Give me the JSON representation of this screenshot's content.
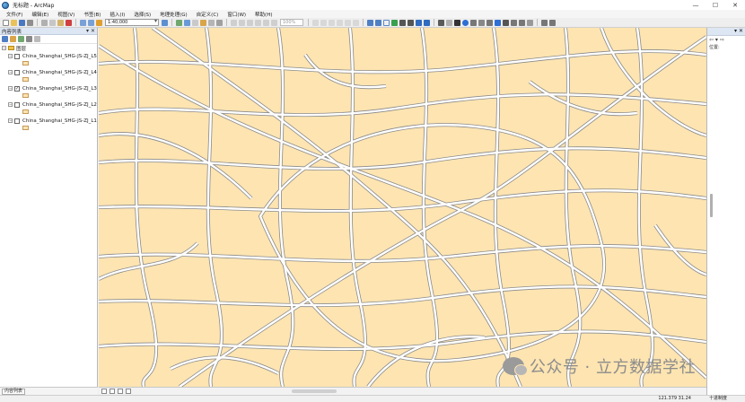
{
  "window": {
    "title": "无标题 - ArcMap",
    "controls": {
      "minimize": "—",
      "maximize": "☐",
      "close": "✕"
    }
  },
  "menu": [
    "文件(F)",
    "编辑(E)",
    "视图(V)",
    "书签(B)",
    "插入(I)",
    "选择(S)",
    "地理处理(G)",
    "自定义(C)",
    "窗口(W)",
    "帮助(H)"
  ],
  "toolbar": {
    "scale": "1:40,000",
    "zoom_level": "100%",
    "icons": [
      "new-file-icon",
      "open-icon",
      "save-icon",
      "print-icon",
      "cut-icon",
      "copy-icon",
      "paste-icon",
      "delete-icon",
      "undo-icon",
      "redo-icon",
      "add-data-icon",
      "zoom-in-icon",
      "zoom-out-icon",
      "pan-icon",
      "full-extent-icon",
      "select-icon",
      "identify-icon",
      "measure-icon"
    ]
  },
  "toc": {
    "title": "内容列表",
    "header_buttons": "▾ ✕",
    "root_label": "图层",
    "layers": [
      {
        "name": "China_Shanghai_SHG-JS-ZJ_L5",
        "checked": false
      },
      {
        "name": "China_Shanghai_SHG-JS-ZJ_L4",
        "checked": false
      },
      {
        "name": "China_Shanghai_SHG-JS-ZJ_L3",
        "checked": true
      },
      {
        "name": "China_Shanghai_SHG-JS-ZJ_L2",
        "checked": false
      },
      {
        "name": "China_Shanghai_SHG-JS-ZJ_L1",
        "checked": false
      }
    ],
    "bottom_tab": "内容列表"
  },
  "right_panel": {
    "header_buttons": "▾ ✕",
    "nav": "⇦ ▾ ⇨",
    "label": "位置:"
  },
  "map": {
    "fill_color": "#fde4b1",
    "road_color": "#ffffff",
    "road_casing": "#8a8a8a",
    "watermark": "公众号 · 立方数据学社"
  },
  "status": {
    "coordinates": "121.379  31.24",
    "units": "十进制度"
  }
}
